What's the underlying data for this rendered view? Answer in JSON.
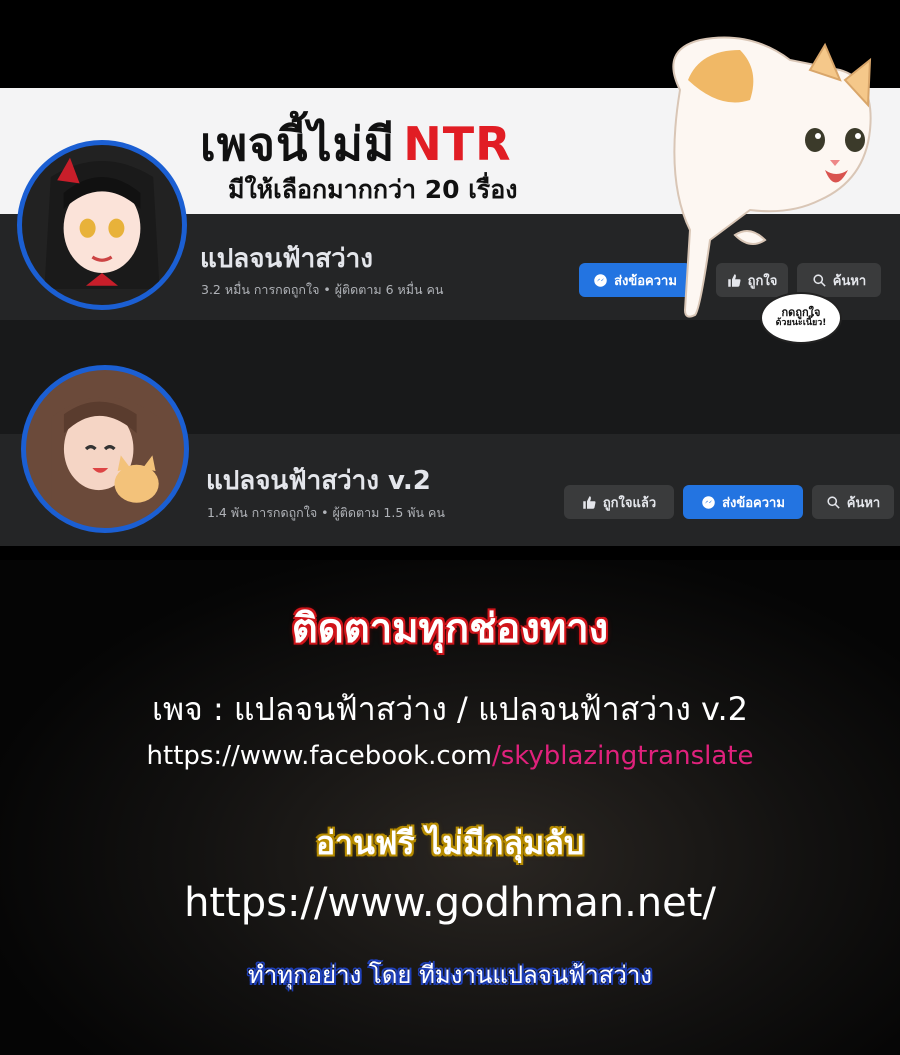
{
  "banner": {
    "title": "เพจนี้ไม่มี",
    "title_accent": "NTR",
    "subtitle": "มีให้เลือกมากกว่า 20 เรื่อง"
  },
  "page1": {
    "name": "แปลจนฟ้าสว่าง",
    "stats": "3.2 หมื่น การกดถูกใจ • ผู้ติดตาม 6 หมื่น คน",
    "message_label": "ส่งข้อความ",
    "like_label": "ถูกใจ",
    "search_label": "ค้นหา"
  },
  "page2": {
    "name": "แปลจนฟ้าสว่าง v.2",
    "stats": "1.4 พัน การกดถูกใจ • ผู้ติดตาม 1.5 พัน คน",
    "liked_label": "ถูกใจแล้ว",
    "message_label": "ส่งข้อความ",
    "search_label": "ค้นหา"
  },
  "speech_bubble": {
    "line1": "กดถูกใจ",
    "line2": "ด้วยนะเนี๊ยว!"
  },
  "promo": {
    "follow_title": "ติดตามทุกช่องทาง",
    "pages_line": "เพจ : แปลจนฟ้าสว่าง / แปลจนฟ้าสว่าง v.2",
    "fb_link_head": "https://www.facebook.com",
    "fb_link_tail": "/skyblazingtranslate",
    "read_free": "อ่านฟรี ไม่มีกลุ่มลับ",
    "site_link": "https://www.godhman.net/",
    "credit": "ทำทุกอย่าง โดย ทีมงานแปลจนฟ้าสว่าง"
  },
  "icons": {
    "messenger": "messenger-icon",
    "like": "thumbs-up-icon",
    "search": "search-icon"
  },
  "colors": {
    "facebook_blue": "#2374e1",
    "card_bg": "#242526",
    "ntr_red": "#e11d24",
    "link_pink": "#e0217c"
  }
}
